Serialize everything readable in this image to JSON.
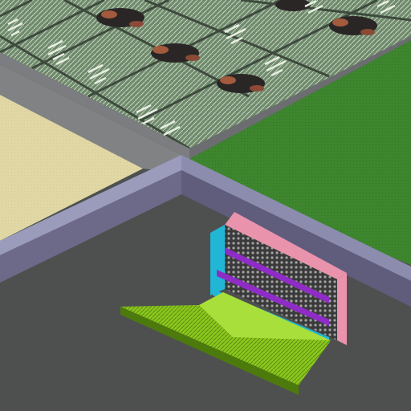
{
  "scene": {
    "title": "",
    "view": "isometric",
    "colors": {
      "background": "#4a4c4d",
      "floor_dark": "#4e5050",
      "beige_floor": "#e0d7a5",
      "grass": "#3d862e",
      "wall_top": "#8f8fb0",
      "wall_face": "#6d6a89",
      "roof_base": "#6f8a6d",
      "roof_line": "#c7d4c0",
      "pink": "#e993ad",
      "dark_rack": "#3a3a3a",
      "purple": "#8f2cc6",
      "cyan": "#21b6d5",
      "lime": "#8bc81d"
    },
    "objects": [
      {
        "name": "rooftop-panels",
        "kind": "terrain"
      },
      {
        "name": "beige-floor",
        "kind": "terrain"
      },
      {
        "name": "grass-lawn",
        "kind": "terrain"
      },
      {
        "name": "purple-wall",
        "kind": "structure"
      },
      {
        "name": "server-rack",
        "kind": "structure"
      },
      {
        "name": "lime-ramp",
        "kind": "structure"
      }
    ]
  }
}
